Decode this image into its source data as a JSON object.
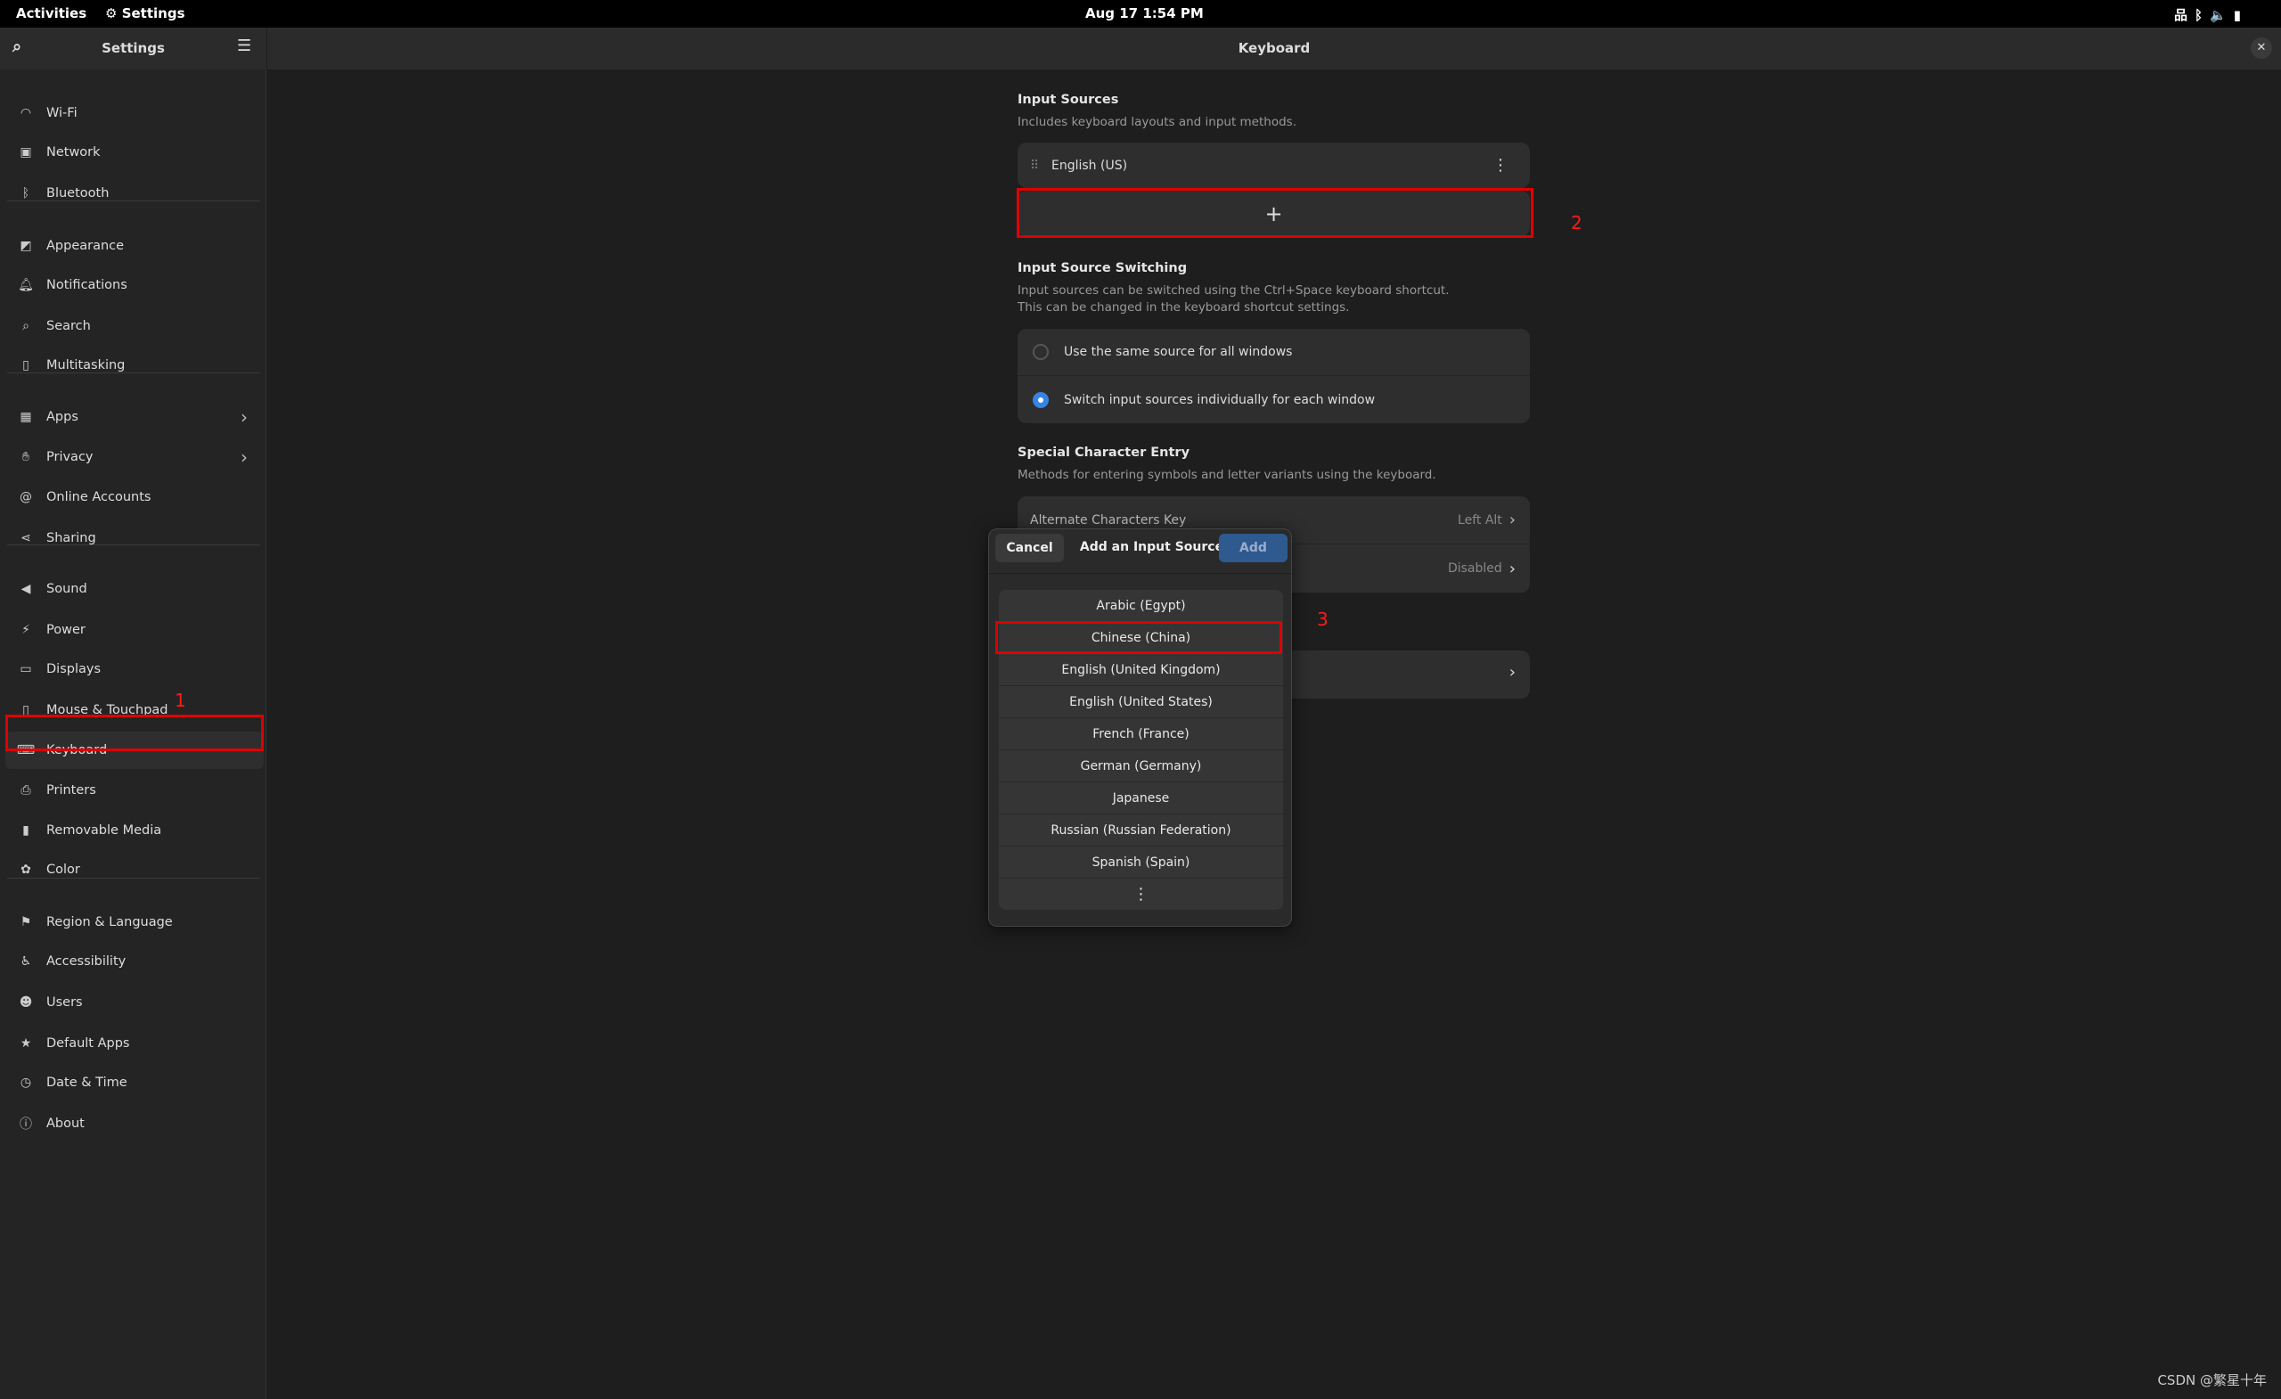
{
  "topbar": {
    "activities": "Activities",
    "app": "Settings",
    "datetime": "Aug 17   1:54 PM",
    "tray_icons": [
      "network-wired-icon",
      "bluetooth-icon",
      "volume-icon",
      "battery-icon"
    ]
  },
  "sidebar": {
    "title": "Settings",
    "items": [
      {
        "label": "Wi-Fi",
        "icon": "wifi-icon"
      },
      {
        "label": "Network",
        "icon": "network-icon"
      },
      {
        "label": "Bluetooth",
        "icon": "bluetooth-icon"
      },
      {
        "label": "Appearance",
        "icon": "appearance-icon"
      },
      {
        "label": "Notifications",
        "icon": "bell-icon"
      },
      {
        "label": "Search",
        "icon": "search-icon"
      },
      {
        "label": "Multitasking",
        "icon": "multitasking-icon"
      },
      {
        "label": "Apps",
        "icon": "apps-icon"
      },
      {
        "label": "Privacy",
        "icon": "hand-icon"
      },
      {
        "label": "Online Accounts",
        "icon": "at-icon"
      },
      {
        "label": "Sharing",
        "icon": "share-icon"
      },
      {
        "label": "Sound",
        "icon": "speaker-icon"
      },
      {
        "label": "Power",
        "icon": "power-icon"
      },
      {
        "label": "Displays",
        "icon": "display-icon"
      },
      {
        "label": "Mouse & Touchpad",
        "icon": "mouse-icon"
      },
      {
        "label": "Keyboard",
        "icon": "keyboard-icon"
      },
      {
        "label": "Printers",
        "icon": "printer-icon"
      },
      {
        "label": "Removable Media",
        "icon": "usb-icon"
      },
      {
        "label": "Color",
        "icon": "color-icon"
      },
      {
        "label": "Region & Language",
        "icon": "flag-icon"
      },
      {
        "label": "Accessibility",
        "icon": "accessibility-icon"
      },
      {
        "label": "Users",
        "icon": "users-icon"
      },
      {
        "label": "Default Apps",
        "icon": "star-icon"
      },
      {
        "label": "Date & Time",
        "icon": "clock-icon"
      },
      {
        "label": "About",
        "icon": "info-icon"
      }
    ],
    "selected": "Keyboard"
  },
  "main": {
    "title": "Keyboard",
    "input_sources": {
      "title": "Input Sources",
      "subtitle": "Includes keyboard layouts and input methods.",
      "items": [
        "English (US)"
      ],
      "add": "+"
    },
    "switching": {
      "title": "Input Source Switching",
      "subtitle1": "Input sources can be switched using the Ctrl+Space keyboard shortcut.",
      "subtitle2": "This can be changed in the keyboard shortcut settings.",
      "options": [
        "Use the same source for all windows",
        "Switch input sources individually for each window"
      ],
      "selected_index": 1
    },
    "special": {
      "title": "Special Character Entry",
      "subtitle": "Methods for entering symbols and letter variants using the keyboard.",
      "rows": [
        {
          "label": "Alternate Characters Key",
          "value": "Left Alt"
        },
        {
          "label": "",
          "value": "Disabled"
        }
      ]
    }
  },
  "dialog": {
    "cancel": "Cancel",
    "title": "Add an Input Source",
    "add": "Add",
    "items": [
      "Arabic (Egypt)",
      "Chinese (China)",
      "English (United Kingdom)",
      "English (United States)",
      "French (France)",
      "German (Germany)",
      "Japanese",
      "Russian (Russian Federation)",
      "Spanish (Spain)"
    ],
    "more": "⋮",
    "selected": "Chinese (China)"
  },
  "annotations": [
    "1",
    "2",
    "3"
  ],
  "watermark": "CSDN @繁星十年",
  "colors": {
    "accent": "#3584e4",
    "add_button": "#2f5a8f",
    "annotation": "#e00000"
  }
}
